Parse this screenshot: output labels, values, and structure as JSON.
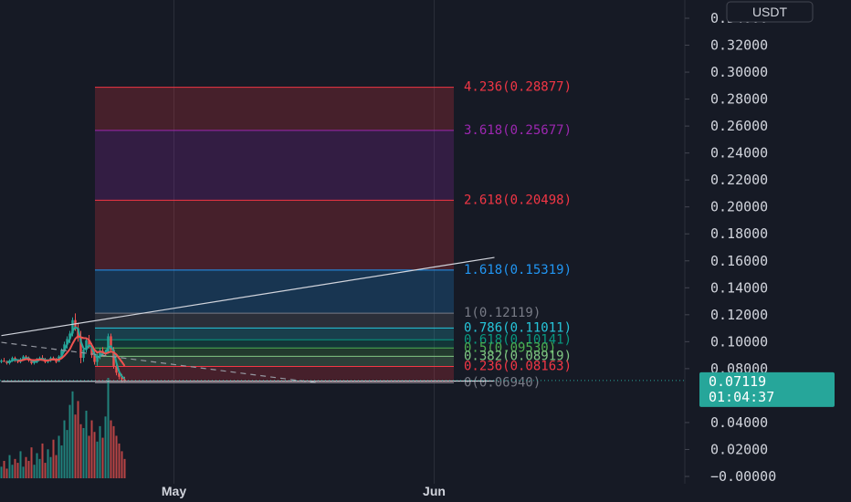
{
  "pair": {
    "quote_currency": "USDT"
  },
  "price_axis": {
    "ticks": [
      "0.34000",
      "0.32000",
      "0.30000",
      "0.28000",
      "0.26000",
      "0.24000",
      "0.22000",
      "0.20000",
      "0.18000",
      "0.16000",
      "0.14000",
      "0.12000",
      "0.10000",
      "0.08000",
      "0.04000",
      "0.02000",
      "−0.00000"
    ],
    "tick_values": [
      0.34,
      0.32,
      0.3,
      0.28,
      0.26,
      0.24,
      0.22,
      0.2,
      0.18,
      0.16,
      0.14,
      0.12,
      0.1,
      0.08,
      0.04,
      0.02,
      0.0
    ]
  },
  "current_price": {
    "value": 0.07119,
    "label": "0.07119",
    "countdown": "01:04:37",
    "color": "#26a69a"
  },
  "time_axis": {
    "labels": [
      "May",
      "Jun"
    ]
  },
  "fib_levels": [
    {
      "ratio": 4.236,
      "price": 0.28877,
      "label": "4.236(0.28877)",
      "color": "#f23645"
    },
    {
      "ratio": 3.618,
      "price": 0.25677,
      "label": "3.618(0.25677)",
      "color": "#9c27b0"
    },
    {
      "ratio": 2.618,
      "price": 0.20498,
      "label": "2.618(0.20498)",
      "color": "#f23645"
    },
    {
      "ratio": 1.618,
      "price": 0.15319,
      "label": "1.618(0.15319)",
      "color": "#2196f3"
    },
    {
      "ratio": 1,
      "price": 0.12119,
      "label": "1(0.12119)",
      "color": "#787b86"
    },
    {
      "ratio": 0.786,
      "price": 0.11011,
      "label": "0.786(0.11011)",
      "color": "#26c6da"
    },
    {
      "ratio": 0.618,
      "price": 0.10141,
      "label": "0.618(0.10141)",
      "color": "#089981"
    },
    {
      "ratio": 0.5,
      "price": 0.0953,
      "label": "0.5(0.09530)",
      "color": "#4caf50"
    },
    {
      "ratio": 0.382,
      "price": 0.08919,
      "label": "0.382(0.08919)",
      "color": "#81c784"
    },
    {
      "ratio": 0.236,
      "price": 0.08163,
      "label": "0.236(0.08163)",
      "color": "#f23645"
    },
    {
      "ratio": 0,
      "price": 0.0694,
      "label": "0(0.06940)",
      "color": "#787b86"
    }
  ],
  "colors": {
    "background": "#161a25",
    "axis_text": "#d1d4dc",
    "grid": "#2a2e39",
    "up": "#26a69a",
    "down": "#ef5350"
  },
  "chart_data": {
    "type": "candlestick",
    "candles": [
      [
        0.085,
        0.087,
        0.084,
        0.086
      ],
      [
        0.086,
        0.088,
        0.085,
        0.085
      ],
      [
        0.085,
        0.086,
        0.083,
        0.084
      ],
      [
        0.084,
        0.087,
        0.083,
        0.086
      ],
      [
        0.086,
        0.089,
        0.085,
        0.088
      ],
      [
        0.088,
        0.089,
        0.085,
        0.086
      ],
      [
        0.086,
        0.087,
        0.084,
        0.085
      ],
      [
        0.085,
        0.088,
        0.084,
        0.087
      ],
      [
        0.087,
        0.09,
        0.086,
        0.089
      ],
      [
        0.089,
        0.09,
        0.087,
        0.088
      ],
      [
        0.088,
        0.089,
        0.085,
        0.086
      ],
      [
        0.086,
        0.087,
        0.083,
        0.084
      ],
      [
        0.084,
        0.086,
        0.083,
        0.085
      ],
      [
        0.085,
        0.088,
        0.084,
        0.087
      ],
      [
        0.087,
        0.089,
        0.086,
        0.088
      ],
      [
        0.088,
        0.09,
        0.086,
        0.087
      ],
      [
        0.087,
        0.088,
        0.084,
        0.085
      ],
      [
        0.085,
        0.087,
        0.084,
        0.086
      ],
      [
        0.086,
        0.089,
        0.085,
        0.088
      ],
      [
        0.088,
        0.089,
        0.086,
        0.087
      ],
      [
        0.087,
        0.088,
        0.084,
        0.085
      ],
      [
        0.085,
        0.09,
        0.085,
        0.089
      ],
      [
        0.089,
        0.095,
        0.088,
        0.094
      ],
      [
        0.094,
        0.1,
        0.092,
        0.098
      ],
      [
        0.098,
        0.104,
        0.095,
        0.102
      ],
      [
        0.102,
        0.108,
        0.099,
        0.106
      ],
      [
        0.106,
        0.118,
        0.104,
        0.116
      ],
      [
        0.116,
        0.121,
        0.108,
        0.11
      ],
      [
        0.11,
        0.114,
        0.1,
        0.103
      ],
      [
        0.103,
        0.108,
        0.084,
        0.088
      ],
      [
        0.088,
        0.096,
        0.085,
        0.094
      ],
      [
        0.094,
        0.103,
        0.092,
        0.101
      ],
      [
        0.101,
        0.105,
        0.095,
        0.097
      ],
      [
        0.097,
        0.099,
        0.088,
        0.09
      ],
      [
        0.09,
        0.093,
        0.083,
        0.085
      ],
      [
        0.085,
        0.091,
        0.082,
        0.089
      ],
      [
        0.089,
        0.095,
        0.087,
        0.093
      ],
      [
        0.093,
        0.096,
        0.089,
        0.091
      ],
      [
        0.091,
        0.094,
        0.089,
        0.092
      ],
      [
        0.092,
        0.106,
        0.091,
        0.104
      ],
      [
        0.104,
        0.106,
        0.092,
        0.094
      ],
      [
        0.094,
        0.096,
        0.08,
        0.082
      ],
      [
        0.082,
        0.084,
        0.075,
        0.077
      ],
      [
        0.077,
        0.079,
        0.072,
        0.074
      ],
      [
        0.074,
        0.076,
        0.07,
        0.072
      ],
      [
        0.072,
        0.074,
        0.07,
        0.071
      ]
    ],
    "volumes": [
      6,
      9,
      5,
      12,
      7,
      10,
      8,
      14,
      6,
      11,
      9,
      16,
      7,
      13,
      10,
      18,
      8,
      15,
      11,
      20,
      12,
      22,
      17,
      30,
      25,
      38,
      45,
      33,
      40,
      28,
      26,
      35,
      22,
      30,
      24,
      19,
      27,
      21,
      32,
      52,
      30,
      27,
      22,
      18,
      14,
      10
    ],
    "trend_lines": [
      {
        "style": "solid",
        "from": [
          0,
          0.1045
        ],
        "to": [
          180,
          0.1625
        ]
      },
      {
        "style": "dashed",
        "from": [
          0,
          0.0995
        ],
        "to": [
          115,
          0.0695
        ]
      },
      {
        "style": "solid",
        "from": [
          0,
          0.0705
        ],
        "to": [
          180,
          0.0708
        ]
      }
    ],
    "ylim": [
      -0.008,
      0.37
    ],
    "x_bars": 180,
    "month_bars": {
      "May": 63,
      "Jun": 158
    }
  }
}
